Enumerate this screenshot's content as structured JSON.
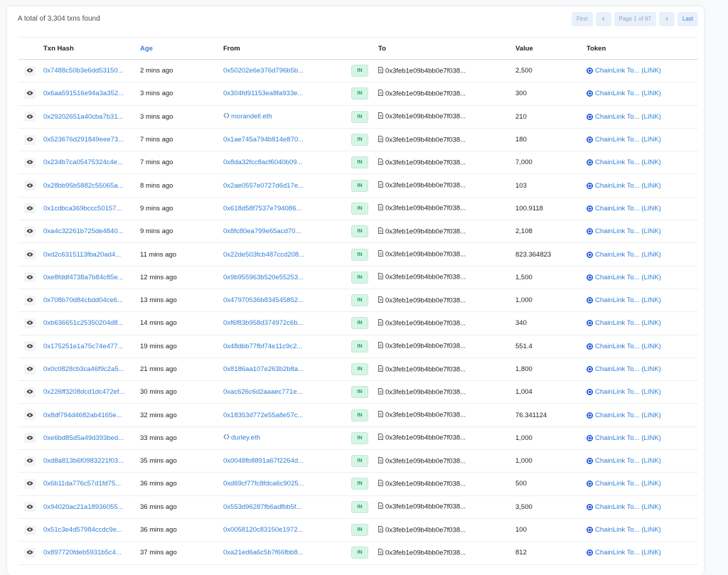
{
  "summary": "A total of 3,304 txns found",
  "pagination": {
    "first": "First",
    "prev": "‹",
    "page": "Page 1 of 67",
    "next": "›",
    "last": "Last"
  },
  "headers": {
    "hash": "Txn Hash",
    "age": "Age",
    "from": "From",
    "to": "To",
    "value": "Value",
    "token": "Token"
  },
  "direction_label": "IN",
  "to_address": "0x3feb1e09b4bb0e7f038...",
  "token_name": "ChainLink To... (LINK)",
  "rows": [
    {
      "hash": "0x7488c50b3e6dd53150...",
      "age": "2 mins ago",
      "from": "0x50202e6e376d796b5b...",
      "from_ens": false,
      "value": "2,500"
    },
    {
      "hash": "0x6aa591516e94a3a352...",
      "age": "3 mins ago",
      "from": "0x304fd91153ea8fa933e...",
      "from_ens": false,
      "value": "300"
    },
    {
      "hash": "0x29202651a40cba7b31...",
      "age": "3 mins ago",
      "from": "morandell.eth",
      "from_ens": true,
      "value": "210"
    },
    {
      "hash": "0x523676d291849eee73...",
      "age": "7 mins ago",
      "from": "0x1ae745a794b814e870...",
      "from_ens": false,
      "value": "180"
    },
    {
      "hash": "0x234b7ca05475324c4e...",
      "age": "7 mins ago",
      "from": "0x8da32fcc8acf6040b09...",
      "from_ens": false,
      "value": "7,000"
    },
    {
      "hash": "0x28bb95b5882c55065a...",
      "age": "8 mins ago",
      "from": "0x2ae0557e0727d6d17e...",
      "from_ens": false,
      "value": "103"
    },
    {
      "hash": "0x1cdbca369bccc50157...",
      "age": "9 mins ago",
      "from": "0x618d58f7537e794086...",
      "from_ens": false,
      "value": "100.9118"
    },
    {
      "hash": "0xa4c32261b725de4840...",
      "age": "9 mins ago",
      "from": "0x8fc80ea799e65acd70...",
      "from_ens": false,
      "value": "2,108"
    },
    {
      "hash": "0xd2c6315113fba20ad4...",
      "age": "11 mins ago",
      "from": "0x22de503fcb487ccd208...",
      "from_ens": false,
      "value": "823.364823"
    },
    {
      "hash": "0xe8fddf4738a7b84c85e...",
      "age": "12 mins ago",
      "from": "0x9b955963b520e55253...",
      "from_ens": false,
      "value": "1,500"
    },
    {
      "hash": "0x708b70d84cbdd04ce6...",
      "age": "13 mins ago",
      "from": "0x47970536b834545852...",
      "from_ens": false,
      "value": "1,000"
    },
    {
      "hash": "0xb636651c25350204d8...",
      "age": "14 mins ago",
      "from": "0xf6f83b958d374972c6b...",
      "from_ens": false,
      "value": "340"
    },
    {
      "hash": "0x175251e1a75c74e477...",
      "age": "19 mins ago",
      "from": "0x48dbb77fbf74e11c9c2...",
      "from_ens": false,
      "value": "551.4"
    },
    {
      "hash": "0x0c0828cb3ca46f9c2a5...",
      "age": "21 mins ago",
      "from": "0x8186aa107e263b2b8a...",
      "from_ens": false,
      "value": "1,800"
    },
    {
      "hash": "0x226ff3208dcd1dc472ef...",
      "age": "30 mins ago",
      "from": "0xac626c6d2aaaec771e...",
      "from_ens": false,
      "value": "1,004"
    },
    {
      "hash": "0x8df794d4682ab4165e...",
      "age": "32 mins ago",
      "from": "0x18353d772e55a8e57c...",
      "from_ens": false,
      "value": "76.341124"
    },
    {
      "hash": "0xe6bd85d5a49d393bed...",
      "age": "33 mins ago",
      "from": "durley.eth",
      "from_ens": true,
      "value": "1,000"
    },
    {
      "hash": "0xd8a813b6f0983221f03...",
      "age": "35 mins ago",
      "from": "0x0048fb8891a67f2264d...",
      "from_ens": false,
      "value": "1,000"
    },
    {
      "hash": "0x6b11da776c57d1fd75...",
      "age": "36 mins ago",
      "from": "0xd69cf77fc8fdca6c9025...",
      "from_ens": false,
      "value": "500"
    },
    {
      "hash": "0x94020ac21a18936055...",
      "age": "36 mins ago",
      "from": "0x553d96287fb6adfbb5f...",
      "from_ens": false,
      "value": "3,500"
    },
    {
      "hash": "0x51c3e4d57984ccdc9e...",
      "age": "36 mins ago",
      "from": "0x0058120c83150e1972...",
      "from_ens": false,
      "value": "100"
    },
    {
      "hash": "0x897720fdeb5931b5c4...",
      "age": "37 mins ago",
      "from": "0xa21ed6a6c5b7f66fbb8...",
      "from_ens": false,
      "value": "812"
    }
  ],
  "colors": {
    "link": "#2e7fd8",
    "in_badge_bg": "#d6f5e6",
    "in_badge_text": "#1f9e62",
    "token_icon": "#2a5ada"
  },
  "icons": {
    "eye": "eye-icon",
    "contract": "contract-document-icon",
    "ens": "ens-icon",
    "token": "chainlink-token-icon"
  }
}
